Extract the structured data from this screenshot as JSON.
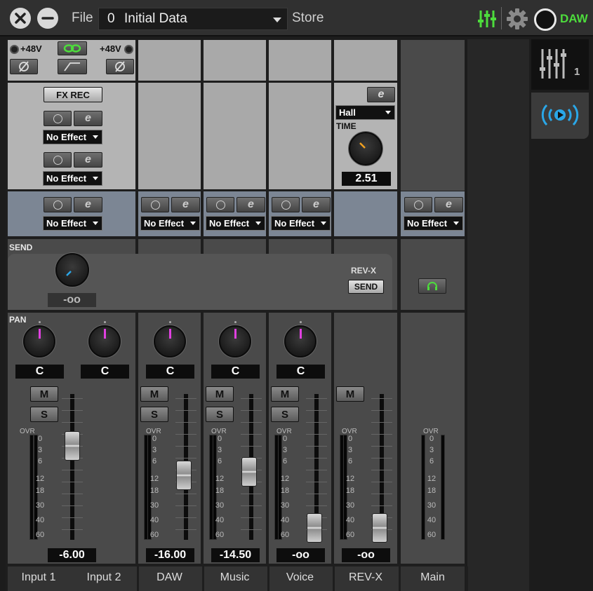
{
  "toolbar": {
    "file_label": "File",
    "scene_number": "0",
    "scene_name": "Initial Data",
    "store_label": "Store",
    "daw_label": "DAW",
    "colors": {
      "green": "#4ddc3c",
      "accent_blue": "#2aa7e8"
    }
  },
  "input": {
    "phantom_label_1": "+48V",
    "phantom_label_2": "+48V",
    "fx_rec_label": "FX REC"
  },
  "effects": {
    "no_effect": "No Effect",
    "reverb_type": "Hall",
    "time_label": "TIME",
    "time_value": "2.51"
  },
  "send": {
    "title": "SEND",
    "value": "-oo",
    "revx_label": "REV-X",
    "send_button": "SEND"
  },
  "pan": {
    "title": "PAN",
    "values": [
      "C",
      "C",
      "C",
      "C",
      "C"
    ]
  },
  "buttons": {
    "mute": "M",
    "solo": "S"
  },
  "meter": {
    "ovr": "OVR",
    "scale": [
      "0",
      "3",
      "6",
      "12",
      "18",
      "30",
      "40",
      "60"
    ]
  },
  "faders": {
    "values": [
      "-6.00",
      "-16.00",
      "-14.50",
      "-oo",
      "-oo"
    ]
  },
  "channels": [
    "Input 1",
    "Input 2",
    "DAW",
    "Music",
    "Voice",
    "REV-X",
    "Main"
  ],
  "sidebar": {
    "mixer_tab_number": "1"
  }
}
